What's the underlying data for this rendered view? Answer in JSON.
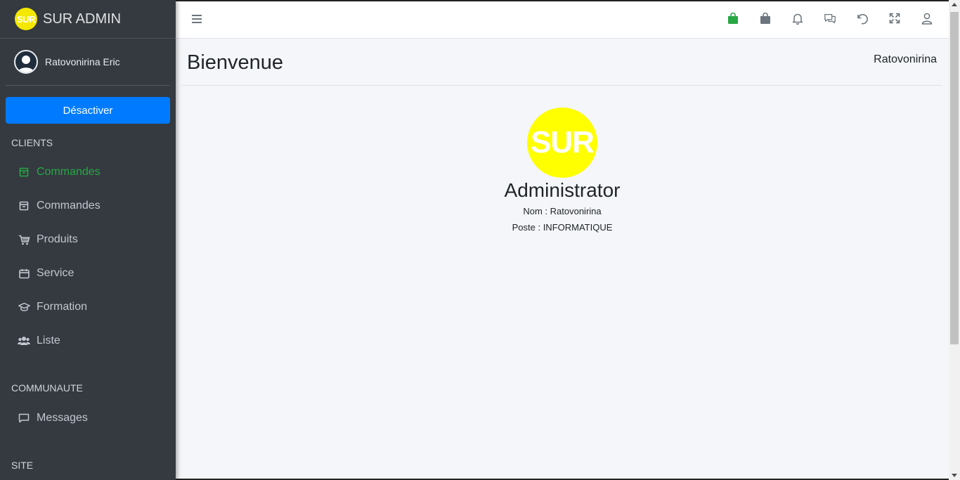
{
  "brand": {
    "logo_text": "SUR",
    "title": "SUR ADMIN",
    "logo_color": "#f5e800"
  },
  "user": {
    "name": "Ratovonirina Eric"
  },
  "sidebar": {
    "deactivate_label": "Désactiver",
    "sections": [
      {
        "header": "CLIENTS"
      },
      {
        "header": "COMMUNAUTE"
      },
      {
        "header": "SITE"
      }
    ],
    "items": [
      {
        "label": "Commandes",
        "icon": "archive-icon",
        "active": true
      },
      {
        "label": "Commandes",
        "icon": "archive-icon"
      },
      {
        "label": "Produits",
        "icon": "cart-icon"
      },
      {
        "label": "Service",
        "icon": "calendar-icon"
      },
      {
        "label": "Formation",
        "icon": "graduation-cap-icon"
      },
      {
        "label": "Liste",
        "icon": "users-icon"
      },
      {
        "label": "Messages",
        "icon": "message-icon"
      }
    ]
  },
  "topbar": {
    "icons": [
      "shopping-bag-green-icon",
      "shopping-bag-icon",
      "bell-icon",
      "comments-icon",
      "undo-icon",
      "expand-icon",
      "user-icon"
    ],
    "accent": "#28a745"
  },
  "content": {
    "title": "Bienvenue",
    "breadcrumb": "Ratovonirina"
  },
  "profile": {
    "logo_text": "SUR",
    "role": "Administrator",
    "nom": "Nom : Ratovonirina",
    "poste": "Poste : INFORMATIQUE"
  },
  "colors": {
    "sidebar_bg": "#343a40",
    "primary": "#007bff",
    "active": "#28a745",
    "content_bg": "#f4f6f9"
  }
}
